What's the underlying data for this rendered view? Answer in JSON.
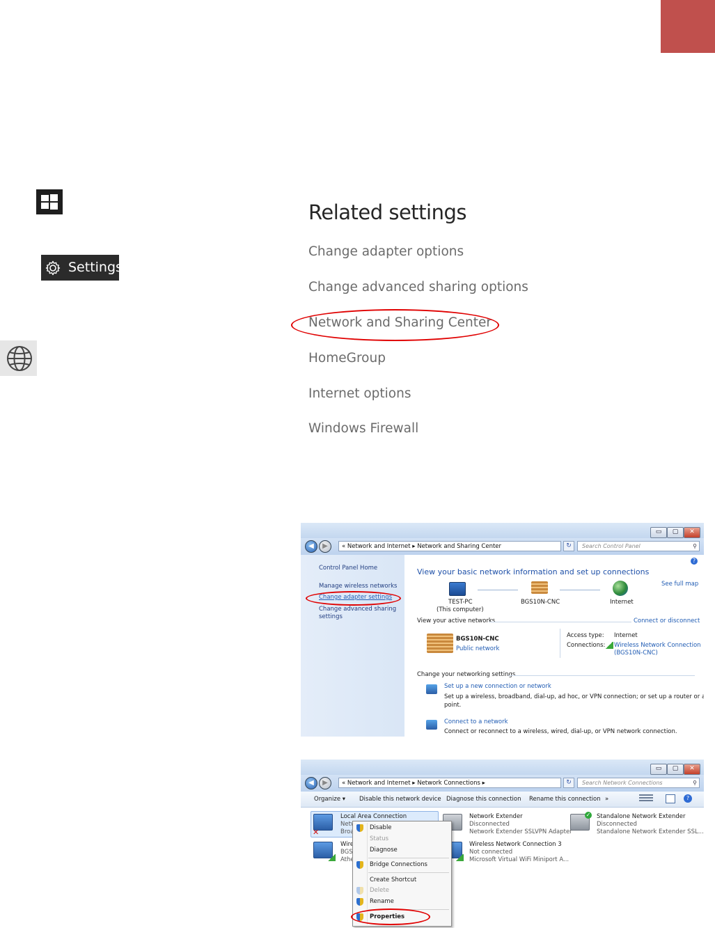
{
  "related": {
    "title": "Related settings",
    "links": [
      "Change adapter options",
      "Change advanced sharing options",
      "Network and Sharing Center",
      "HomeGroup",
      "Internet options",
      "Windows Firewall"
    ]
  },
  "start": {
    "settings_label": "Settings"
  },
  "sharing_window": {
    "window_buttons": {
      "minimize": "▭",
      "maximize": "▢",
      "close": "✕"
    },
    "address": "« Network and Internet ▸ Network and Sharing Center",
    "search_placeholder": "Search Control Panel",
    "sidebar": {
      "home": "Control Panel Home",
      "manage_wireless": "Manage wireless networks",
      "change_adapter": "Change adapter settings",
      "change_advanced_1": "Change advanced sharing",
      "change_advanced_2": "settings"
    },
    "heading": "View your basic network information and set up connections",
    "see_full_map": "See full map",
    "map": {
      "pc": "TEST-PC",
      "pc_sub": "(This computer)",
      "network": "BGS10N-CNC",
      "internet": "Internet"
    },
    "active_networks_label": "View your active networks",
    "connect_disconnect": "Connect or disconnect",
    "network_name": "BGS10N-CNC",
    "network_type": "Public network",
    "access_type_label": "Access type:",
    "access_type_value": "Internet",
    "connections_label": "Connections:",
    "connection_value_1": "Wireless Network Connection",
    "connection_value_2": "(BGS10N-CNC)",
    "change_settings_label": "Change your networking settings",
    "setup_link": "Set up a new connection or network",
    "setup_desc_1": "Set up a wireless, broadband, dial-up, ad hoc, or VPN connection; or set up a router or access",
    "setup_desc_2": "point.",
    "connect_link": "Connect to a network",
    "connect_desc": "Connect or reconnect to a wireless, wired, dial-up, or VPN network connection."
  },
  "connections_window": {
    "address": "« Network and Internet ▸ Network Connections ▸",
    "search_placeholder": "Search Network Connections",
    "toolbar": [
      "Organize ▾",
      "Disable this network device",
      "Diagnose this connection",
      "Rename this connection",
      "»"
    ],
    "adapters": [
      {
        "name": "Local Area Connection",
        "line2": "Netw",
        "line3": "Broa"
      },
      {
        "name": "Wire",
        "line2": "BGS",
        "line3": "Athe"
      },
      {
        "name": "Network Extender",
        "line2": "Disconnected",
        "line3": "Network Extender SSLVPN Adapter"
      },
      {
        "name": "Wireless Network Connection 3",
        "line2": "Not connected",
        "line3": "Microsoft Virtual WiFi Miniport A..."
      },
      {
        "name": "Standalone Network Extender",
        "line2": "Disconnected",
        "line3": "Standalone Network Extender SSL..."
      }
    ],
    "context_menu": [
      "Disable",
      "Status",
      "Diagnose",
      "Bridge Connections",
      "Create Shortcut",
      "Delete",
      "Rename",
      "Properties"
    ]
  }
}
